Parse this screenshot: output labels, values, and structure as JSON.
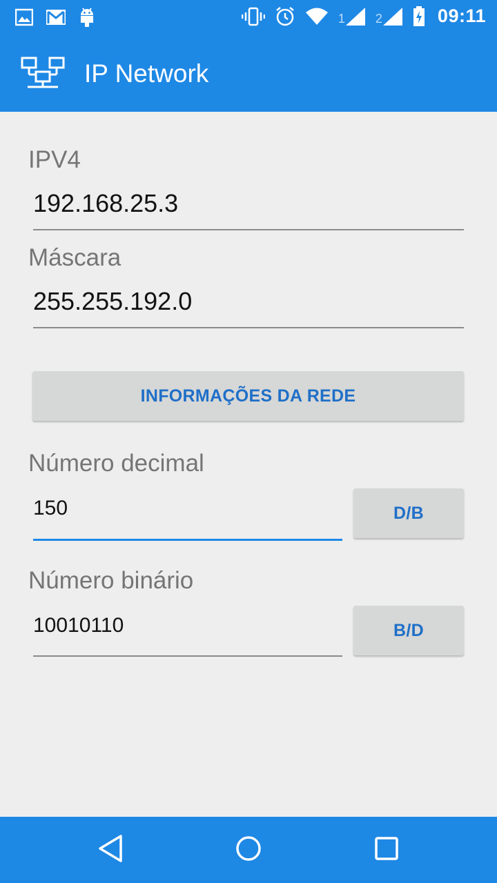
{
  "status_bar": {
    "time": "09:11",
    "sim1": "1",
    "sim2": "2",
    "icons": [
      "image-icon",
      "gmail-icon",
      "android-icon",
      "vibrate-icon",
      "alarm-icon",
      "wifi-icon",
      "signal-icon",
      "signal-icon",
      "battery-charging-icon"
    ]
  },
  "app_bar": {
    "title": "IP Network",
    "logo_icon": "network-icon"
  },
  "form": {
    "ipv4_label": "IPV4",
    "ipv4_value": "192.168.25.3",
    "mask_label": "Máscara",
    "mask_value": "255.255.192.0",
    "network_info_button": "INFORMAÇÕES DA REDE",
    "decimal_label": "Número decimal",
    "decimal_value": "150",
    "decimal_to_binary_button": "D/B",
    "binary_label": "Número binário",
    "binary_value": "10010110",
    "binary_to_decimal_button": "B/D"
  },
  "nav_bar": {
    "back_icon": "back-triangle-icon",
    "home_icon": "home-circle-icon",
    "recents_icon": "recents-square-icon"
  },
  "colors": {
    "primary": "#1e88e5",
    "background": "#eeeeee",
    "button": "#d6d7d7",
    "button_text": "#1f6fc8"
  }
}
